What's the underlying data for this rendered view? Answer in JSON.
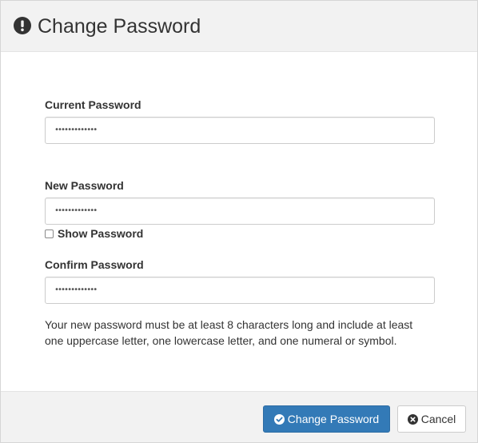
{
  "dialog": {
    "title": "Change Password",
    "header_icon": "exclamation-circle-icon"
  },
  "form": {
    "current_password": {
      "label": "Current Password",
      "value": "•••••••••••••"
    },
    "new_password": {
      "label": "New Password",
      "value": "•••••••••••••"
    },
    "show_password": {
      "label": "Show Password",
      "checked": false
    },
    "confirm_password": {
      "label": "Confirm Password",
      "value": "•••••••••••••"
    },
    "help_lines": [
      "Your new password must be at least 8 characters long and include at least",
      "one uppercase letter, one lowercase letter, and one numeral or symbol."
    ]
  },
  "footer": {
    "submit_label": "Change Password",
    "submit_icon": "check-circle-icon",
    "cancel_label": "Cancel",
    "cancel_icon": "times-circle-icon"
  },
  "colors": {
    "primary": "#337ab7",
    "header_bg": "#f2f2f2"
  }
}
